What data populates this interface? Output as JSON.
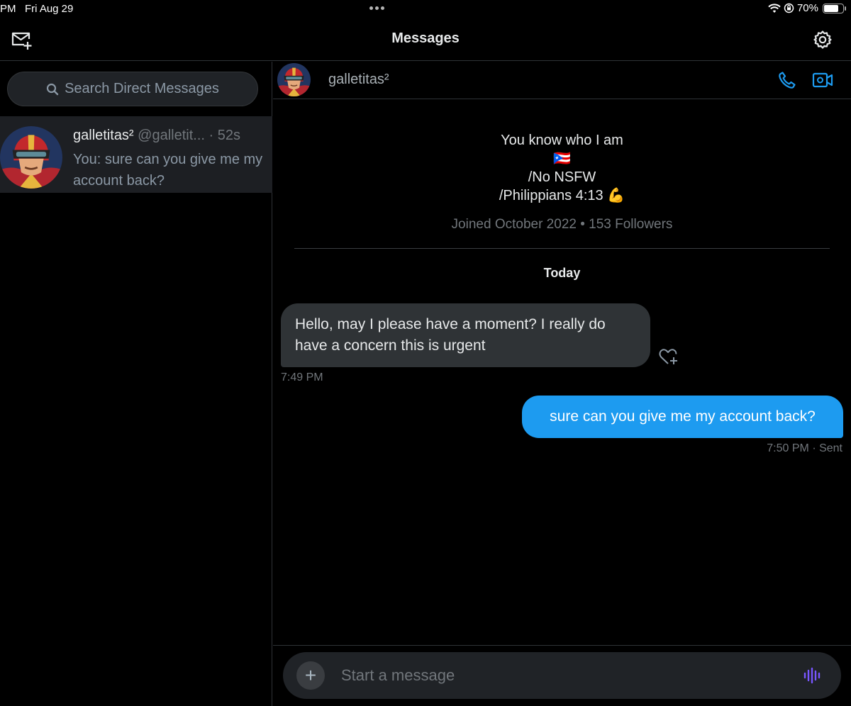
{
  "status_bar": {
    "time": "PM",
    "date": "Fri Aug 29",
    "battery": "70%",
    "battery_level": 0.7
  },
  "header": {
    "title": "Messages",
    "compose_icon": "compose-message-icon",
    "settings_icon": "gear-icon"
  },
  "search": {
    "placeholder": "Search Direct Messages",
    "icon": "search-icon"
  },
  "conversations": [
    {
      "name": "galletitas²",
      "handle": "@galletit...",
      "age": "· 52s",
      "preview": "You: sure can you give me my account back?"
    }
  ],
  "chat": {
    "name": "galletitas²",
    "call_icon": "phone-icon",
    "video_icon": "video-call-icon",
    "bio": {
      "line1": "You know who I am",
      "line2": "🇵🇷",
      "line3": "/No NSFW",
      "line4": "/Philippians 4:13 💪"
    },
    "joined": "Joined October 2022 • 153 Followers",
    "day_label": "Today",
    "messages": [
      {
        "direction": "in",
        "text": "Hello, may I please have a moment? I really do have a concern  this is urgent",
        "time": "7:49 PM"
      },
      {
        "direction": "out",
        "text": "sure can you give me my account back?",
        "time": "7:50 PM · Sent"
      }
    ]
  },
  "composer": {
    "placeholder": "Start a message",
    "plus_label": "+"
  },
  "colors": {
    "accent": "#1d9bf0",
    "background": "#000000",
    "bubble_in": "#2f3336",
    "voice": "#7856ff"
  }
}
